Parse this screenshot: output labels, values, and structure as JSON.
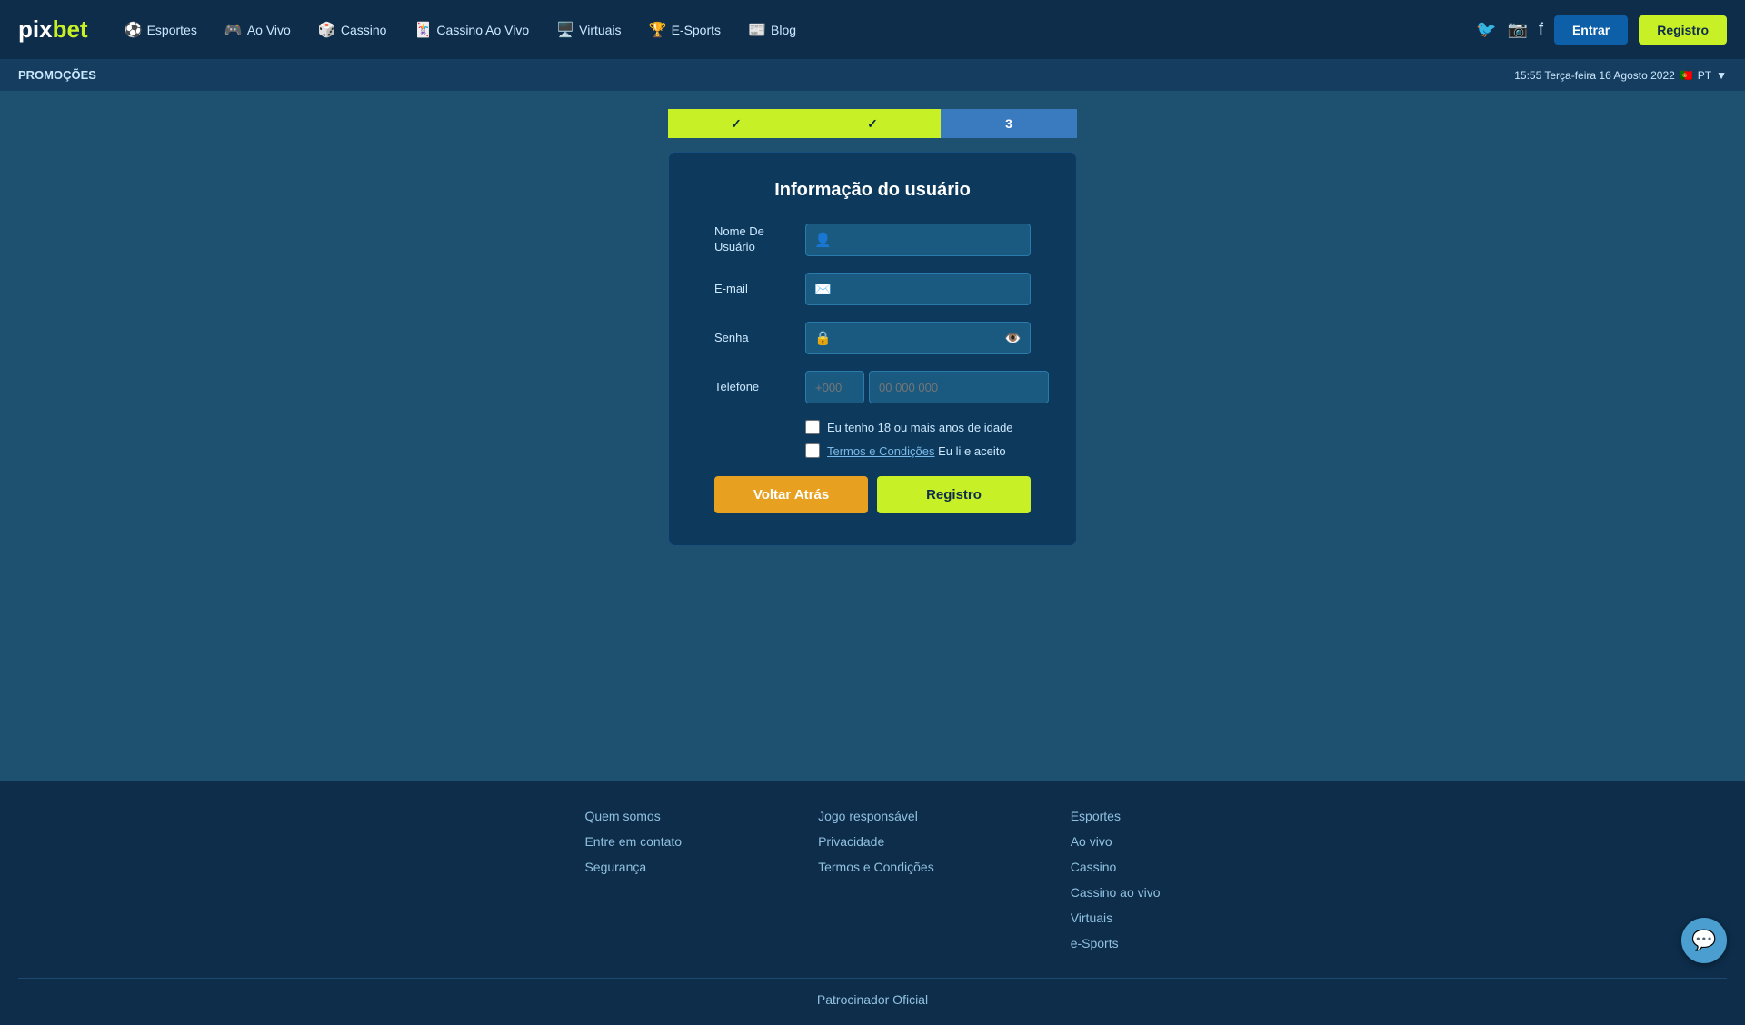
{
  "logo": {
    "pix": "pix",
    "bet": "bet"
  },
  "nav": {
    "items": [
      {
        "id": "esportes",
        "label": "Esportes",
        "icon": "⚽"
      },
      {
        "id": "ao-vivo",
        "label": "Ao Vivo",
        "icon": "🎮"
      },
      {
        "id": "cassino",
        "label": "Cassino",
        "icon": "🎲"
      },
      {
        "id": "cassino-ao-vivo",
        "label": "Cassino Ao Vivo",
        "icon": "🃏"
      },
      {
        "id": "virtuais",
        "label": "Virtuais",
        "icon": "🖥️"
      },
      {
        "id": "e-sports",
        "label": "E-Sports",
        "icon": "🏆"
      },
      {
        "id": "blog",
        "label": "Blog",
        "icon": "📰"
      }
    ],
    "entrar": "Entrar",
    "registro": "Registro"
  },
  "promo_bar": {
    "left": "PROMOÇÕES",
    "right": "15:55 Terça-feira 16 Agosto 2022",
    "lang": "PT"
  },
  "steps": [
    {
      "id": 1,
      "label": "✓",
      "state": "done"
    },
    {
      "id": 2,
      "label": "✓",
      "state": "done"
    },
    {
      "id": 3,
      "label": "3",
      "state": "active"
    }
  ],
  "form": {
    "title": "Informação do usuário",
    "fields": {
      "username_label": "Nome De Usuário",
      "username_placeholder": "",
      "email_label": "E-mail",
      "email_placeholder": "",
      "password_label": "Senha",
      "password_placeholder": "",
      "phone_label": "Telefone",
      "phone_code_placeholder": "+000",
      "phone_number_placeholder": "00 000 000"
    },
    "checkboxes": {
      "age": "Eu tenho 18 ou mais anos de idade",
      "terms_link": "Termos e Condições",
      "terms_rest": " Eu li e aceito"
    },
    "btn_back": "Voltar Atrás",
    "btn_registro": "Registro"
  },
  "footer": {
    "col1": {
      "items": [
        "Quem somos",
        "Entre em contato",
        "Segurança"
      ]
    },
    "col2": {
      "items": [
        "Jogo responsável",
        "Privacidade",
        "Termos e Condições"
      ]
    },
    "col3": {
      "items": [
        "Esportes",
        "Ao vivo",
        "Cassino",
        "Cassino ao vivo",
        "Virtuais",
        "e-Sports"
      ]
    },
    "sponsor": "Patrocinador Oficial"
  },
  "chat": {
    "icon": "💬"
  }
}
